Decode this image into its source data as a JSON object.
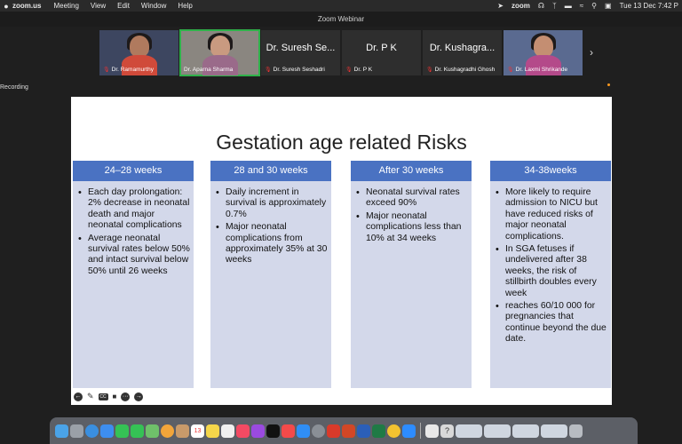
{
  "menubar": {
    "app_name": "zoom.us",
    "items": [
      "Meeting",
      "View",
      "Edit",
      "Window",
      "Help"
    ],
    "center_logo": "zoom",
    "datetime": "Tue 13 Dec  7:42 P"
  },
  "window": {
    "title": "Zoom Webinar"
  },
  "participants": [
    {
      "label": "Dr. Ramamurthy",
      "has_video": true,
      "muted": true
    },
    {
      "label": "Dr. Aparna Sharma",
      "has_video": true,
      "muted": false,
      "active_speaker": true
    },
    {
      "name_large": "Dr. Suresh Se...",
      "label": "Dr. Suresh Seshadri",
      "has_video": false,
      "muted": true
    },
    {
      "name_large": "Dr. P K",
      "label": "Dr. P K",
      "has_video": false,
      "muted": true
    },
    {
      "name_large": "Dr. Kushagra...",
      "label": "Dr. Kushagradhi Ghosh",
      "has_video": false,
      "muted": true
    },
    {
      "label": "Dr. Laxmi Shrikande",
      "has_video": true,
      "muted": true
    }
  ],
  "recording_label": "Recording",
  "slide": {
    "title": "Gestation age related Risks",
    "columns": [
      {
        "header": "24–28 weeks",
        "bullets": [
          "Each day prolongation: 2% decrease in neonatal death and  major neonatal complications",
          "Average neonatal survival rates below 50% and intact survival below 50% until 26 weeks"
        ]
      },
      {
        "header": "28 and 30 weeks",
        "bullets": [
          "Daily increment in survival is approximately 0.7%",
          "Major neonatal complications from approximately 35% at 30 weeks"
        ]
      },
      {
        "header": "After 30 weeks",
        "bullets": [
          "Neonatal survival rates exceed 90%",
          "Major neonatal complications less than 10% at 34 weeks"
        ]
      },
      {
        "header": "34-38weeks",
        "bullets": [
          "More likely to require admission to NICU but have reduced risks of major neonatal complications.",
          " In SGA fetuses if undelivered after 38 weeks, the risk of stillbirth doubles every week",
          "reaches 60/10 000 for pregnancies that continue beyond the due date."
        ]
      }
    ]
  },
  "slide_controls": [
    "prev-arrow-icon",
    "pen-icon",
    "subtitles-icon",
    "video-off-icon",
    "more-icon",
    "next-arrow-icon"
  ],
  "dock": {
    "icons": [
      "finder-icon",
      "launchpad-icon",
      "safari-icon",
      "mail-icon",
      "facetime-icon",
      "messages-icon",
      "maps-icon",
      "photos-icon",
      "contacts-icon",
      "calendar-icon",
      "notes-icon",
      "reminders-icon",
      "music-icon",
      "podcasts-icon",
      "tv-icon",
      "news-icon",
      "appstore-icon",
      "settings-icon",
      "pdf-icon",
      "powerpoint-icon",
      "word-icon",
      "excel-icon",
      "chrome-icon",
      "zoom-icon",
      "preview-icon",
      "help-icon",
      "window-icon",
      "trash-icon"
    ],
    "calendar_day": "13"
  }
}
